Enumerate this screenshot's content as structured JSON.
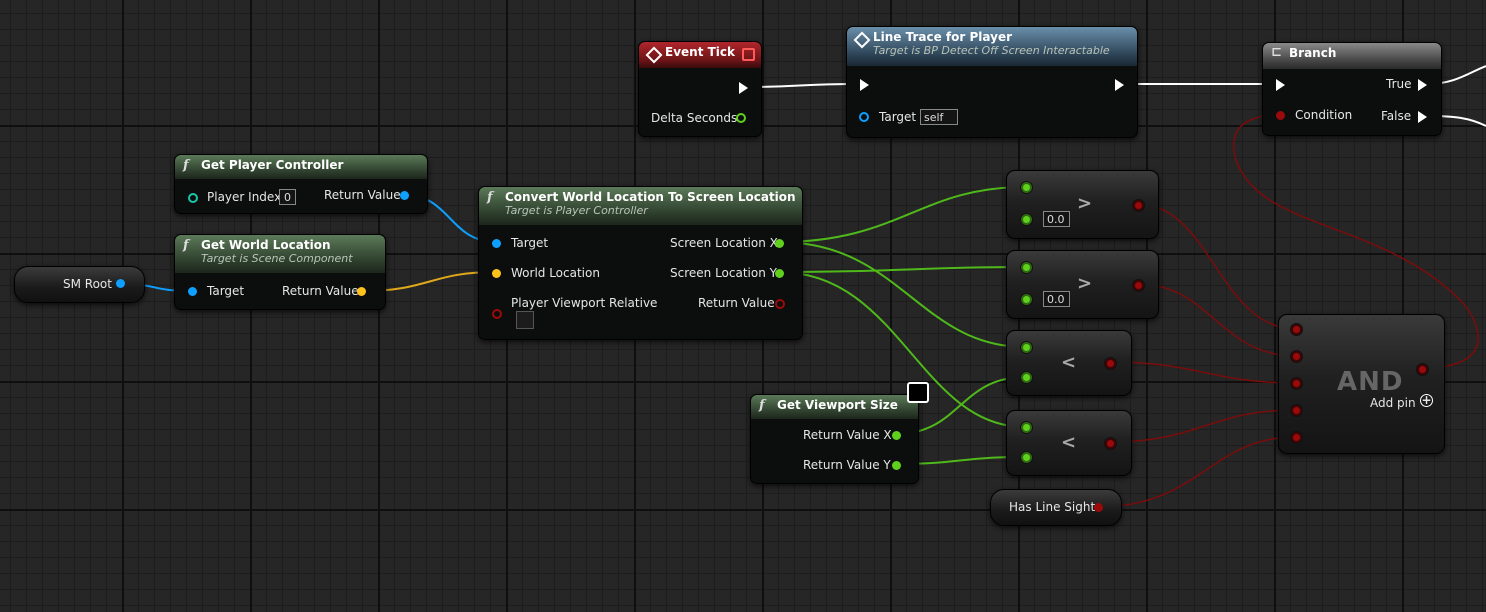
{
  "colors": {
    "exec": "#ffffff",
    "object": "#0ea0ff",
    "vector": "#ffc21a",
    "float": "#5fd11d",
    "bool": "#9b0a0a"
  },
  "nodes": {
    "event_tick": {
      "title": "Event Tick",
      "pins": {
        "delta": "Delta Seconds"
      }
    },
    "line_trace": {
      "title": "Line Trace for Player",
      "subtitle": "Target is BP Detect Off Screen Interactable",
      "pins": {
        "target": "Target",
        "target_value": "self"
      }
    },
    "branch": {
      "title": "Branch",
      "pins": {
        "condition": "Condition",
        "true": "True",
        "false": "False"
      }
    },
    "get_player_controller": {
      "icon": "f",
      "title": "Get Player Controller",
      "pins": {
        "player_index": "Player Index",
        "player_index_value": "0",
        "return": "Return Value"
      }
    },
    "get_world_location": {
      "icon": "f",
      "title": "Get World Location",
      "subtitle": "Target is Scene Component",
      "pins": {
        "target": "Target",
        "return": "Return Value"
      }
    },
    "sm_root": {
      "label": "SM Root"
    },
    "convert": {
      "icon": "f",
      "title": "Convert World Location To Screen Location",
      "subtitle": "Target is Player Controller",
      "pins": {
        "target": "Target",
        "world_location": "World Location",
        "viewport_relative": "Player Viewport Relative",
        "screen_x": "Screen Location X",
        "screen_y": "Screen Location Y",
        "return": "Return Value"
      }
    },
    "gt1": {
      "op": ">",
      "value": "0.0"
    },
    "gt2": {
      "op": ">",
      "value": "0.0"
    },
    "lt1": {
      "op": "<"
    },
    "lt2": {
      "op": "<"
    },
    "get_viewport_size": {
      "icon": "f",
      "title": "Get Viewport Size",
      "pins": {
        "return_x": "Return Value X",
        "return_y": "Return Value Y"
      }
    },
    "has_line_sight": {
      "label": "Has Line Sight"
    },
    "and": {
      "op": "AND",
      "add_pin": "Add pin"
    }
  }
}
